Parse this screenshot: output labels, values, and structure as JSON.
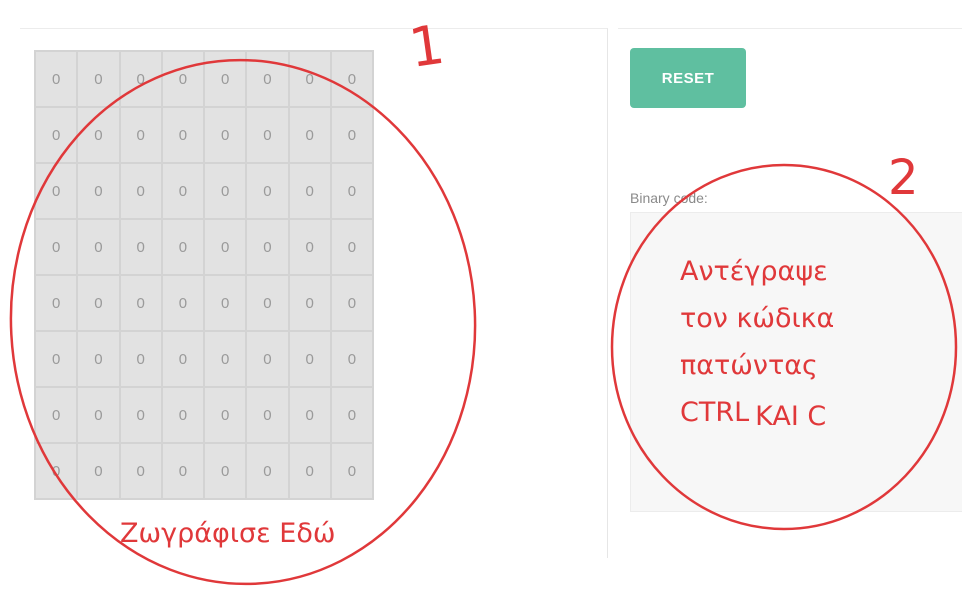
{
  "grid": {
    "rows": [
      [
        "0",
        "0",
        "0",
        "0",
        "0",
        "0",
        "0",
        "0"
      ],
      [
        "0",
        "0",
        "0",
        "0",
        "0",
        "0",
        "0",
        "0"
      ],
      [
        "0",
        "0",
        "0",
        "0",
        "0",
        "0",
        "0",
        "0"
      ],
      [
        "0",
        "0",
        "0",
        "0",
        "0",
        "0",
        "0",
        "0"
      ],
      [
        "0",
        "0",
        "0",
        "0",
        "0",
        "0",
        "0",
        "0"
      ],
      [
        "0",
        "0",
        "0",
        "0",
        "0",
        "0",
        "0",
        "0"
      ],
      [
        "0",
        "0",
        "0",
        "0",
        "0",
        "0",
        "0",
        "0"
      ],
      [
        "0",
        "0",
        "0",
        "0",
        "0",
        "0",
        "0",
        "0"
      ]
    ]
  },
  "controls": {
    "reset_label": "RESET",
    "binary_label": "Binary code:",
    "binary_value": ""
  },
  "annotations": {
    "number_1": "1",
    "number_2": "2",
    "draw_here": "Ζωγράφισε Εδώ",
    "copy_line_1": "Αντέγραψε",
    "copy_line_2": "τον κώδικα",
    "copy_line_3": "πατώντας",
    "copy_line_4a": "CTRL",
    "copy_line_4b": "KAI C"
  },
  "colors": {
    "accent": "#5fbfa0",
    "annotation": "#e0383a",
    "cell": "#e2e2e2"
  }
}
